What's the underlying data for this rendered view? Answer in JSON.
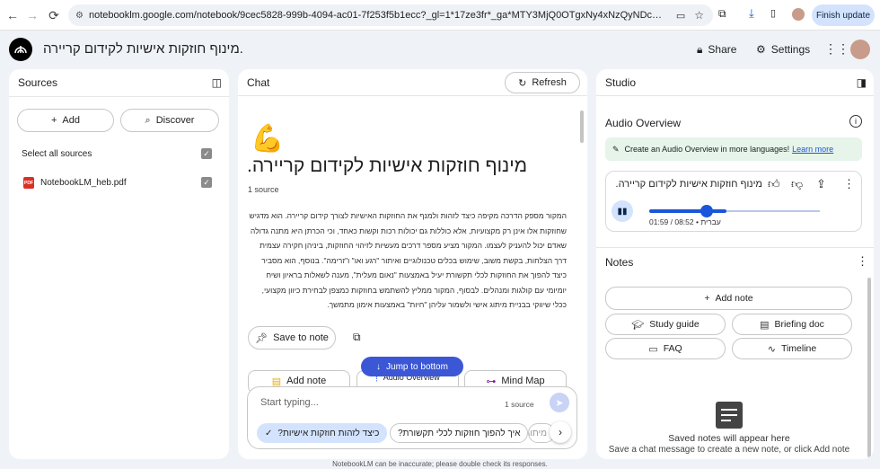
{
  "browser": {
    "url": "notebooklm.google.com/notebook/9cec5828-999b-4094-ac01-7f253f5b1ecc?_gl=1*17ze3fr*_ga*MTY3MjQ0OTgxNy4xNzQyNDc3MDY4*_ga_W0LDH41...",
    "finish_update": "Finish update"
  },
  "app": {
    "title": "מינוף חוזקות אישיות לקידום קריירה.",
    "share": "Share",
    "settings": "Settings"
  },
  "sources": {
    "header": "Sources",
    "add": "Add",
    "discover": "Discover",
    "select_all": "Select all sources",
    "files": [
      {
        "name": "NotebookLM_heb.pdf",
        "badge": "PDF"
      }
    ]
  },
  "chat": {
    "header": "Chat",
    "refresh": "Refresh",
    "title": "מינוף חוזקות אישיות לקידום קריירה.",
    "source_count": "1 source",
    "summary": "המקור מספק הדרכה מקיפה כיצד לזהות ולמנף את החוזקות האישיות לצורך קידום קריירה. הוא מדגיש שחוזקות אלו אינן רק מקצועיות, אלא כוללות גם יכולות רכות וקשות כאחד, וכי הכרתן היא מתנה גדולה שאדם יכול להעניק לעצמו. המקור מציע מספר דרכים מעשיות לזיהוי החוזקות, ביניהן חקירה עצמית דרך הצלחות, בקשת משוב, שימוש בכלים טכנולוגיים ואיתור \"רגע ואו\" ו\"זרימה\". בנוסף, הוא מסביר כיצד להפוך את החוזקות לכלי תקשורת יעיל באמצעות \"נאום מעלית\", מענה לשאלות בראיון ושיח יומיומי עם קולגות ומנהלים. לבסוף, המקור ממליץ להשתמש בחוזקות כמצפן לבחירת כיוון מקצועי, ככלי שיווקי בבניית מיתוג אישי ולשמור עליהן \"חיות\" באמצעות אימון מתמשך.",
    "save_to_note": "Save to note",
    "add_note": "Add note",
    "audio_overview": "Audio Overview",
    "mind_map": "Mind Map",
    "jump_to_bottom": "Jump to bottom",
    "input_placeholder": "Start typing...",
    "input_source_count": "1 source",
    "suggestions": [
      "כיצד לזהות חוזקות אישיות?",
      "איך להפוך חוזקות לכלי תקשורת?",
      "מיתוג..."
    ],
    "disclaimer": "NotebookLM can be inaccurate; please double check its responses."
  },
  "studio": {
    "header": "Studio",
    "audio_overview": "Audio Overview",
    "banner_text": "Create an Audio Overview in more languages!",
    "banner_link": "Learn more",
    "audio_title": "מינוף חוזקות אישיות לקידום קריירה.",
    "audio_time": "01:59 / 08:52 • עברית",
    "audio_progress": 0.23,
    "notes_header": "Notes",
    "add_note": "Add note",
    "study_guide": "Study guide",
    "briefing_doc": "Briefing doc",
    "faq": "FAQ",
    "timeline": "Timeline",
    "saved_notes_title": "Saved notes will appear here",
    "saved_notes_hint": "Save a chat message to create a new note, or click Add note"
  }
}
